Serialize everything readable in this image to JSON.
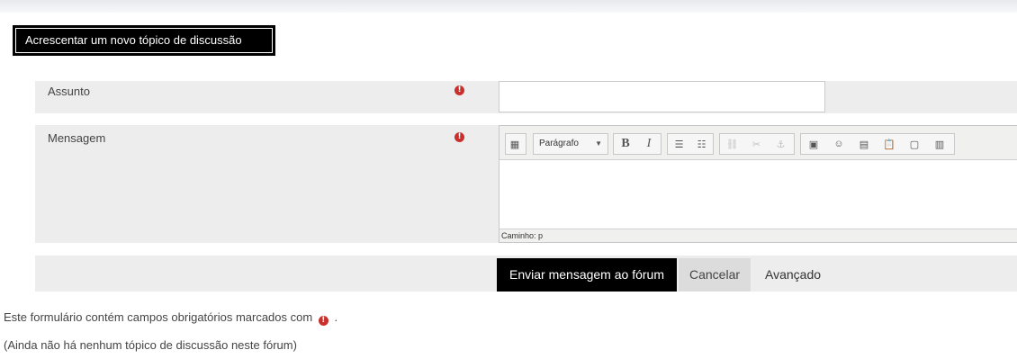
{
  "header": {
    "new_topic_label": "Acrescentar um novo tópico de discussão"
  },
  "form": {
    "subject_label": "Assunto",
    "subject_value": "",
    "message_label": "Mensagem",
    "required_icon": "exclamation-circle-icon",
    "required_color": "#c9302c",
    "required_glyph": "!"
  },
  "editor": {
    "format_value": "Parágrafo",
    "toolbar": [
      {
        "name": "toggle-toolbar-icon",
        "glyph": "▦"
      },
      {
        "name": "bold-icon",
        "glyph": "B"
      },
      {
        "name": "italic-icon",
        "glyph": "I"
      },
      {
        "name": "bullet-list-icon",
        "glyph": "☰"
      },
      {
        "name": "numbered-list-icon",
        "glyph": "☷"
      },
      {
        "name": "link-icon",
        "glyph": "⛓"
      },
      {
        "name": "unlink-icon",
        "glyph": "✂"
      },
      {
        "name": "anchor-icon",
        "glyph": "⚓"
      },
      {
        "name": "image-icon",
        "glyph": "▣"
      },
      {
        "name": "emoticon-icon",
        "glyph": "☺"
      },
      {
        "name": "media-icon",
        "glyph": "▤"
      },
      {
        "name": "paste-icon",
        "glyph": "📋"
      },
      {
        "name": "file-icon",
        "glyph": "▢"
      },
      {
        "name": "file-video-icon",
        "glyph": "▥"
      }
    ],
    "path_label": "Caminho: p"
  },
  "buttons": {
    "submit_label": "Enviar mensagem ao fórum",
    "cancel_label": "Cancelar",
    "advanced_label": "Avançado"
  },
  "notes": {
    "required_text": "Este formulário contém campos obrigatórios marcados com",
    "required_suffix": ".",
    "empty_text": "(Ainda não há nenhum tópico de discussão neste fórum)"
  }
}
